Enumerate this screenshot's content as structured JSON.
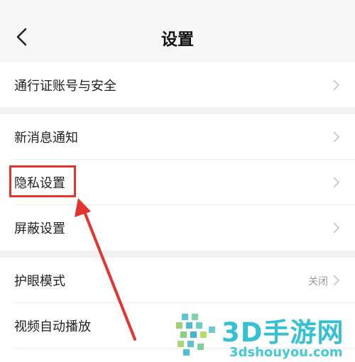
{
  "header": {
    "title": "设置"
  },
  "sections": [
    {
      "items": [
        {
          "label": "通行证账号与安全"
        }
      ]
    },
    {
      "items": [
        {
          "label": "新消息通知"
        },
        {
          "label": "隐私设置"
        },
        {
          "label": "屏蔽设置"
        }
      ]
    },
    {
      "items": [
        {
          "label": "护眼模式",
          "value": "关闭"
        },
        {
          "label": "视频自动播放"
        }
      ]
    }
  ],
  "annotation": {
    "highlight_color": "#e3342f"
  },
  "watermark": {
    "brand": "3D手游网",
    "url": "3dshouyou.com",
    "color": "#35c1d4"
  }
}
